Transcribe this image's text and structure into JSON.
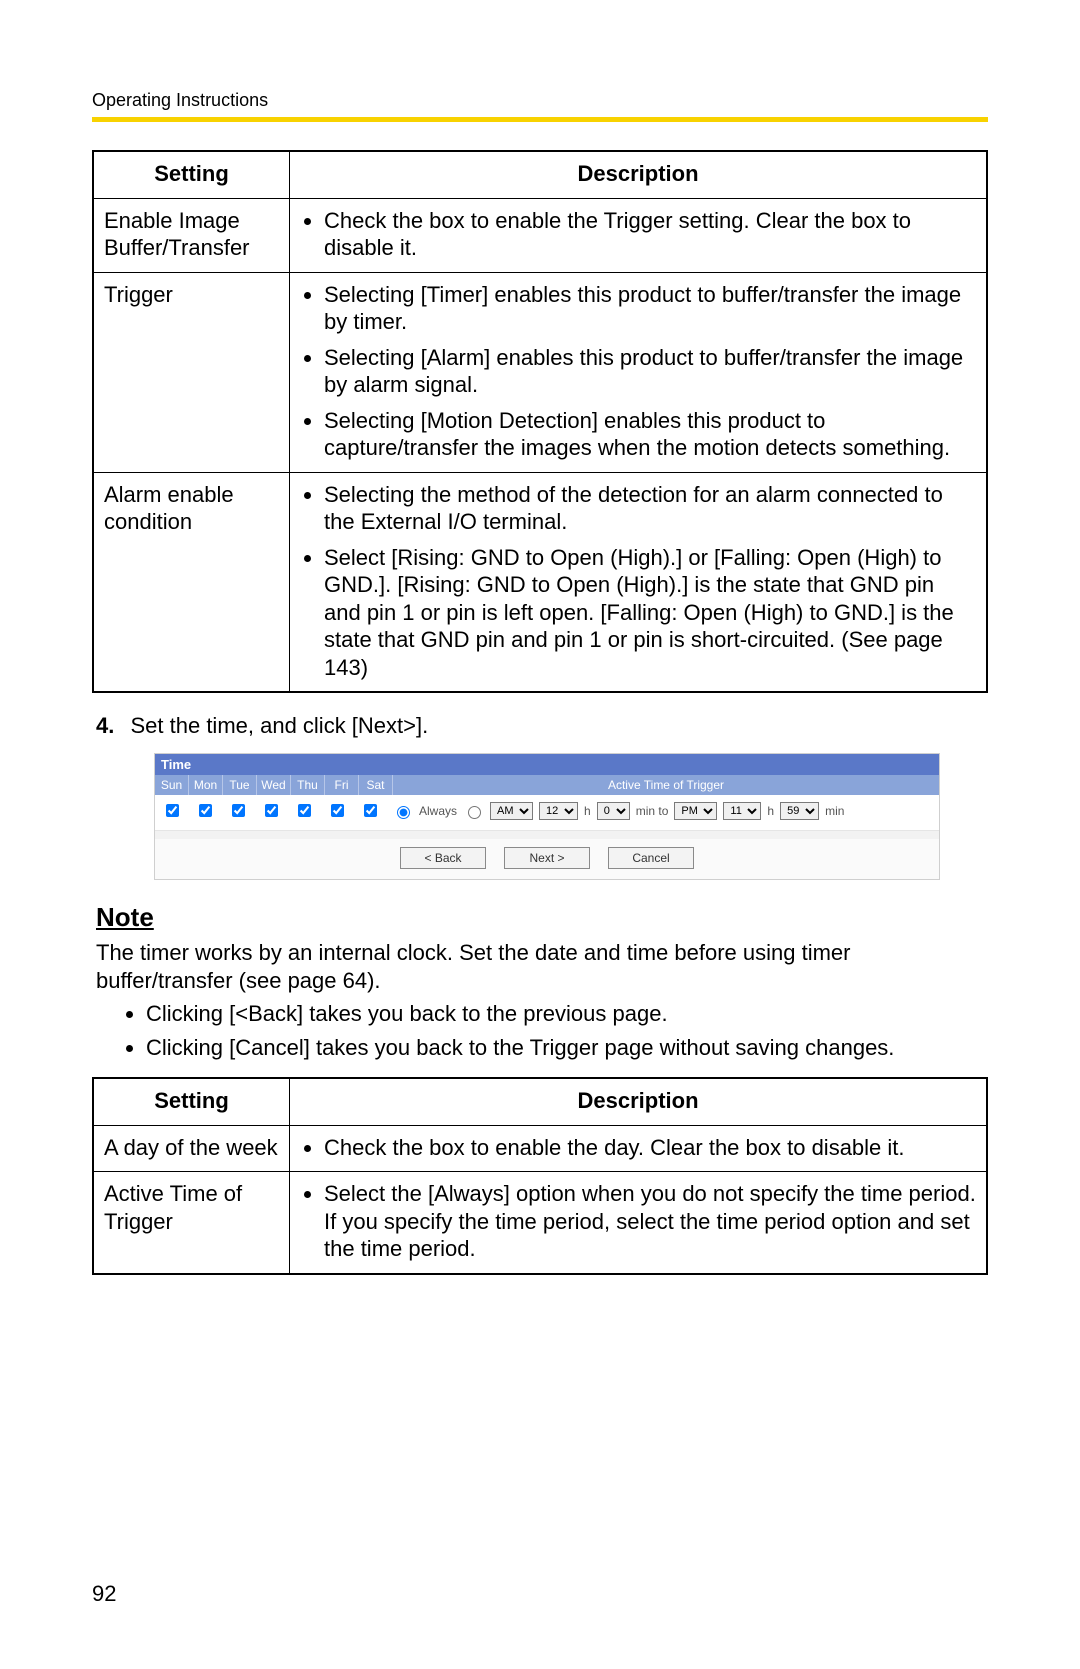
{
  "header": {
    "running": "Operating Instructions"
  },
  "page_number": "92",
  "table1": {
    "head": {
      "setting": "Setting",
      "description": "Description"
    },
    "rows": [
      {
        "setting": "Enable Image Buffer/Transfer",
        "bullets": [
          "Check the box to enable the Trigger setting. Clear the box to disable it."
        ]
      },
      {
        "setting": "Trigger",
        "bullets": [
          "Selecting [Timer] enables this product to buffer/transfer the image by timer.",
          "Selecting [Alarm] enables this product to buffer/transfer the image by alarm signal.",
          "Selecting [Motion Detection] enables this product to capture/transfer the images when the motion detects something."
        ]
      },
      {
        "setting": "Alarm enable condition",
        "bullets": [
          "Selecting the method of the detection for an alarm connected to the External I/O terminal.",
          "Select [Rising: GND to Open (High).] or [Falling: Open (High) to GND.]. [Rising: GND to Open (High).] is the state that GND pin and pin 1 or pin is left open. [Falling: Open (High) to GND.] is the state that GND pin and pin 1 or pin is short-circuited. (See page 143)"
        ]
      }
    ]
  },
  "step4": {
    "num": "4.",
    "text": "Set the time, and click [Next>]."
  },
  "time_panel": {
    "title": "Time",
    "days": [
      "Sun",
      "Mon",
      "Tue",
      "Wed",
      "Thu",
      "Fri",
      "Sat"
    ],
    "active_label": "Active Time of Trigger",
    "checks": [
      true,
      true,
      true,
      true,
      true,
      true,
      true
    ],
    "opts": {
      "always_label": "Always",
      "ampm_from": "AM",
      "h_from": "12",
      "m_from": "0",
      "h_label": "h",
      "min_label": "min to",
      "min_label2": "min",
      "ampm_to": "PM",
      "h_to": "11",
      "m_to": "59"
    },
    "buttons": {
      "back": "< Back",
      "next": "Next >",
      "cancel": "Cancel"
    }
  },
  "note": {
    "heading": "Note",
    "body": "The timer works by an internal clock. Set the date and time before using timer buffer/transfer (see page 64).",
    "bullets": [
      "Clicking [<Back] takes you back to the previous page.",
      "Clicking [Cancel] takes you back to the Trigger page without saving changes."
    ]
  },
  "table2": {
    "head": {
      "setting": "Setting",
      "description": "Description"
    },
    "rows": [
      {
        "setting": "A day of the week",
        "bullets": [
          "Check the box to enable the day. Clear the box to disable it."
        ]
      },
      {
        "setting": "Active Time of Trigger",
        "bullets": [
          "Select the [Always] option when you do not specify the time period. If you specify the time period, select the time period option and set the time period."
        ]
      }
    ]
  }
}
